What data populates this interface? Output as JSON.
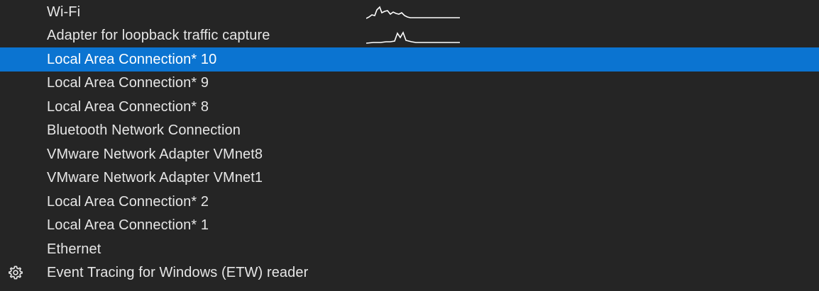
{
  "interfaces": [
    {
      "label": "Wi-Fi",
      "has_sparkline": true,
      "selected": false
    },
    {
      "label": "Adapter for loopback traffic capture",
      "has_sparkline": true,
      "selected": false
    },
    {
      "label": "Local Area Connection* 10",
      "has_sparkline": false,
      "selected": true
    },
    {
      "label": "Local Area Connection* 9",
      "has_sparkline": false,
      "selected": false
    },
    {
      "label": "Local Area Connection* 8",
      "has_sparkline": false,
      "selected": false
    },
    {
      "label": "Bluetooth Network Connection",
      "has_sparkline": false,
      "selected": false
    },
    {
      "label": "VMware Network Adapter VMnet8",
      "has_sparkline": false,
      "selected": false
    },
    {
      "label": "VMware Network Adapter VMnet1",
      "has_sparkline": false,
      "selected": false
    },
    {
      "label": "Local Area Connection* 2",
      "has_sparkline": false,
      "selected": false
    },
    {
      "label": "Local Area Connection* 1",
      "has_sparkline": false,
      "selected": false
    },
    {
      "label": "Ethernet",
      "has_sparkline": false,
      "selected": false
    },
    {
      "label": "Event Tracing for Windows (ETW) reader",
      "has_sparkline": false,
      "selected": false,
      "icon": "gear-icon"
    }
  ],
  "colors": {
    "background": "#252525",
    "text": "#e6e6e6",
    "selected_background": "#0b74d1",
    "selected_text": "#ffffff",
    "sparkline": "#ffffff"
  }
}
